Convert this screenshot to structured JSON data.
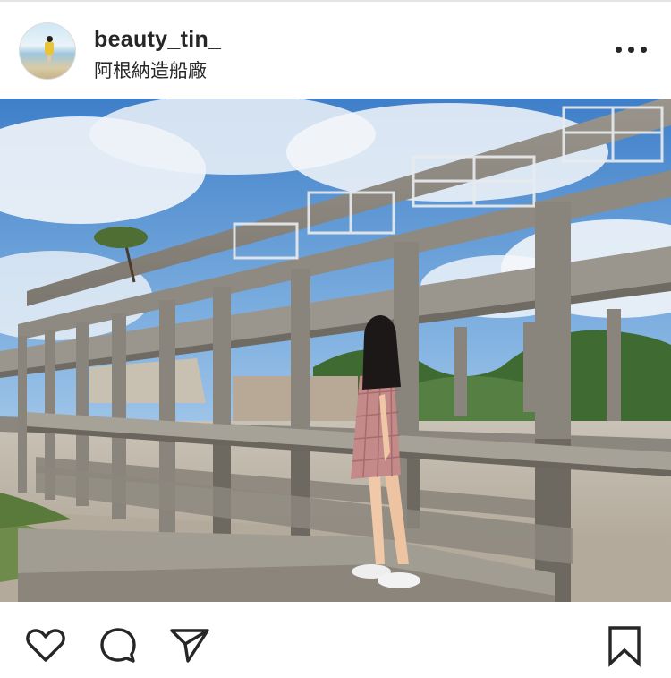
{
  "post": {
    "username": "beauty_tin_",
    "location": "阿根納造船廠"
  },
  "icons": {
    "more": "more-options-icon",
    "like": "heart-icon",
    "comment": "comment-bubble-icon",
    "share": "paper-plane-icon",
    "save": "bookmark-icon"
  },
  "colors": {
    "text": "#262626",
    "background": "#ffffff",
    "divider": "#e4e4e4"
  }
}
